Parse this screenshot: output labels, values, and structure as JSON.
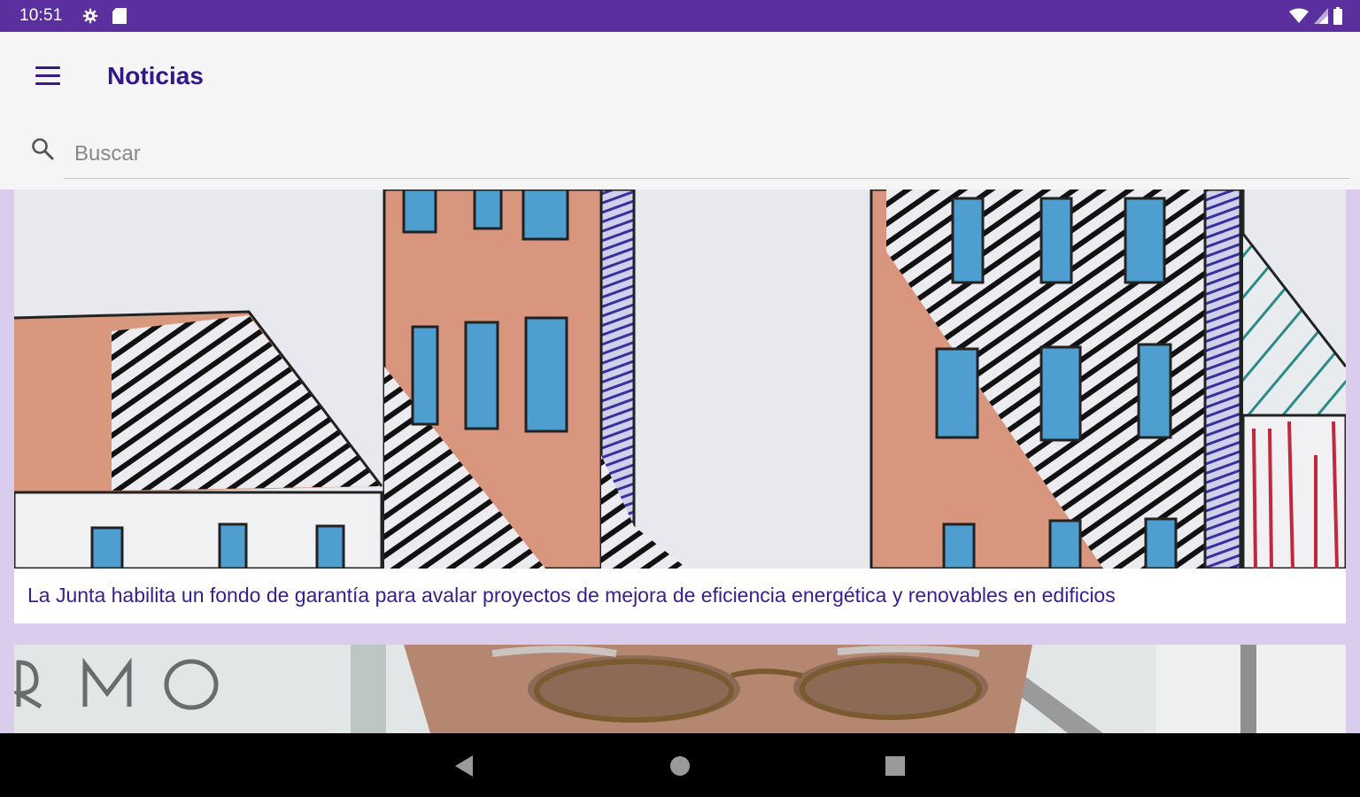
{
  "status_bar": {
    "time": "10:51",
    "icons": [
      "settings-icon",
      "sd-card-icon",
      "wifi-icon",
      "signal-icon",
      "battery-icon"
    ],
    "color": "#5b2f9e"
  },
  "app_bar": {
    "title": "Noticias",
    "menu_icon": "hamburger-menu-icon",
    "title_color": "#33178a"
  },
  "search": {
    "placeholder": "Buscar",
    "value": "",
    "icon": "search-icon"
  },
  "feed": {
    "background": "#d9ccec",
    "cards": [
      {
        "image": "hand-drawn illustration of buildings",
        "title": "La Junta habilita un fondo de garantía para avalar proyectos de mejora de eficiencia energética y renovables en edificios"
      },
      {
        "image": "photo of a man wearing glasses",
        "title": ""
      }
    ]
  },
  "nav_bar": {
    "buttons": [
      "back-icon",
      "home-icon",
      "recents-icon"
    ]
  }
}
